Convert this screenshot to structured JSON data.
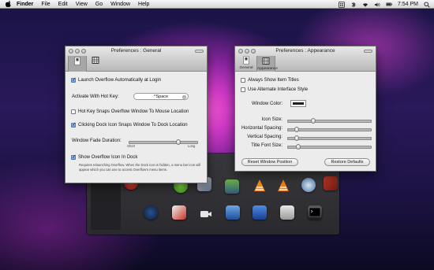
{
  "menubar": {
    "items": [
      "Finder",
      "File",
      "Edit",
      "View",
      "Go",
      "Window",
      "Help"
    ],
    "clock": "7:54 PM"
  },
  "general": {
    "title": "Preferences : General",
    "tabs": [
      {
        "label": "General",
        "icon": "switch-icon"
      },
      {
        "label": "Appearance",
        "icon": "grid-icon"
      }
    ],
    "launch_label": "Launch Overflow Automatically at Login",
    "launch_checked": true,
    "hotkey_label": "Activate With Hot Key:",
    "hotkey_value": "^Space",
    "snap_mouse_label": "Hot Key Snaps Overflow Window To Mouse Location",
    "snap_mouse_checked": false,
    "snap_dock_label": "Clicking Dock Icon Snaps Window To Dock Location",
    "snap_dock_checked": true,
    "fade_label": "Window Fade Duration:",
    "fade_min": "Short",
    "fade_max": "Long",
    "fade_value": 0.72,
    "show_icon_label": "Show Overflow Icon In Dock",
    "show_icon_checked": true,
    "note": "Requires relaunching Overflow. When the Dock icon is hidden, a menu bar icon will appear which you can use to access Overflow's menu items."
  },
  "appearance": {
    "title": "Preferences : Appearance",
    "tabs": [
      {
        "label": "General",
        "icon": "switch-icon"
      },
      {
        "label": "Appearance",
        "icon": "grid-icon"
      }
    ],
    "show_titles_label": "Always Show Item Titles",
    "show_titles_checked": false,
    "alt_style_label": "Use Alternate Interface Style",
    "alt_style_checked": false,
    "color_label": "Window Color:",
    "window_color": "#1e1e1e",
    "sliders": [
      {
        "label": "Icon Size:",
        "value": 0.3
      },
      {
        "label": "Horizontal Spacing:",
        "value": 0.1
      },
      {
        "label": "Vertical Spacing:",
        "value": 0.1
      },
      {
        "label": "Title Font Size:",
        "value": 0.12
      }
    ],
    "reset_button": "Reset Window Position",
    "restore_button": "Restore Defaults"
  },
  "colors": {
    "checkbox_blue": "#6b9cdc",
    "overflow_bg": "#2e2e32"
  }
}
